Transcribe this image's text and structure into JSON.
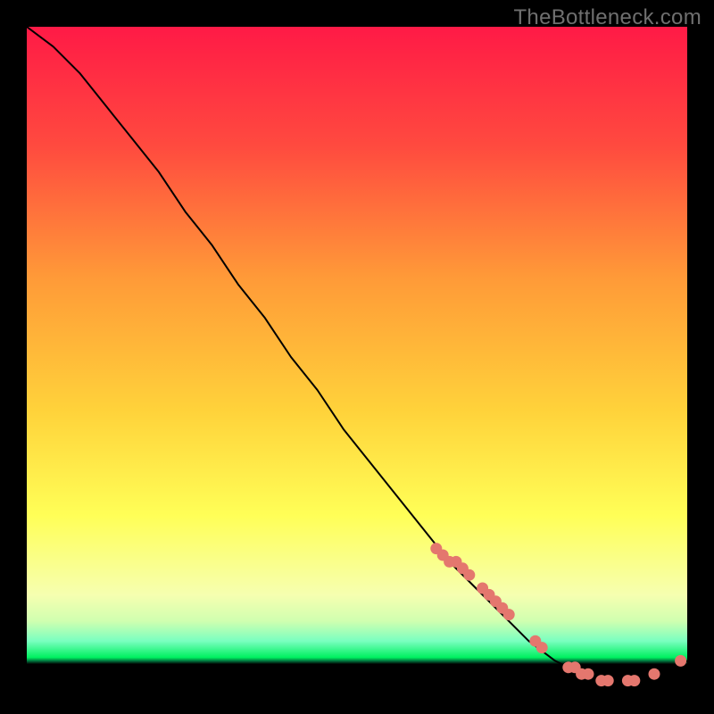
{
  "watermark": "TheBottleneck.com",
  "chart_data": {
    "type": "line",
    "title": "",
    "xlabel": "",
    "ylabel": "",
    "xlim": [
      0,
      100
    ],
    "ylim": [
      0,
      100
    ],
    "grid": false,
    "legend": false,
    "background_gradient": {
      "top": "#ff1a46",
      "mid_upper": "#ff7e3a",
      "mid": "#ffd23a",
      "mid_lower": "#ffff57",
      "lower_band": "#f6ffb0",
      "green_band": "#00f060",
      "bottom_black": "#000000"
    },
    "series": [
      {
        "name": "curve",
        "type": "line",
        "color": "#000000",
        "x": [
          0,
          4,
          8,
          12,
          16,
          20,
          24,
          28,
          32,
          36,
          40,
          44,
          48,
          52,
          56,
          60,
          64,
          68,
          72,
          76,
          80,
          84,
          88,
          92,
          96,
          100
        ],
        "y": [
          100,
          97,
          93,
          88,
          83,
          78,
          72,
          67,
          61,
          56,
          50,
          45,
          39,
          34,
          29,
          24,
          19,
          15,
          11,
          7,
          4,
          2,
          1,
          1,
          2,
          4
        ]
      },
      {
        "name": "points",
        "type": "scatter",
        "color": "#e4776e",
        "x": [
          62,
          63,
          64,
          65,
          66,
          67,
          69,
          70,
          71,
          72,
          73,
          77,
          78,
          82,
          83,
          84,
          85,
          87,
          88,
          91,
          92,
          95,
          99
        ],
        "y": [
          21,
          20,
          19,
          19,
          18,
          17,
          15,
          14,
          13,
          12,
          11,
          7,
          6,
          3,
          3,
          2,
          2,
          1,
          1,
          1,
          1,
          2,
          4
        ]
      }
    ]
  }
}
